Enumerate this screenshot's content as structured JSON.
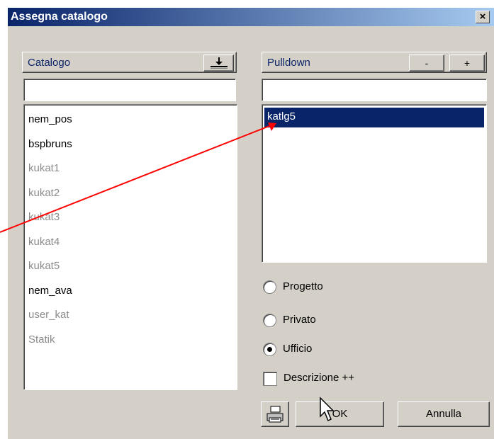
{
  "window": {
    "title": "Assegna catalogo",
    "close_label": "×"
  },
  "left_panel": {
    "header": "Catalogo",
    "download_icon": "download-to-tray-icon",
    "items": [
      {
        "label": "nem_pos",
        "state": "active"
      },
      {
        "label": "bspbruns",
        "state": "active"
      },
      {
        "label": "kukat1",
        "state": "inactive"
      },
      {
        "label": "kukat2",
        "state": "inactive"
      },
      {
        "label": "kukat3",
        "state": "inactive"
      },
      {
        "label": "kukat4",
        "state": "inactive"
      },
      {
        "label": "kukat5",
        "state": "inactive"
      },
      {
        "label": "nem_ava",
        "state": "active"
      },
      {
        "label": "user_kat",
        "state": "inactive"
      },
      {
        "label": "Statik",
        "state": "inactive"
      }
    ]
  },
  "right_panel": {
    "header": "Pulldown",
    "minus_label": "-",
    "plus_label": "+",
    "selected_item": "katlg5"
  },
  "options": {
    "radios": [
      "Progetto",
      "Privato",
      "Ufficio"
    ],
    "selected_radio": "Ufficio",
    "checkbox_label": "Descrizione ++",
    "checkbox_checked": false
  },
  "buttons": {
    "ok": "OK",
    "cancel": "Annulla",
    "print_icon": "printer-icon"
  },
  "annotation": {
    "arrow_color": "#ff0000"
  }
}
